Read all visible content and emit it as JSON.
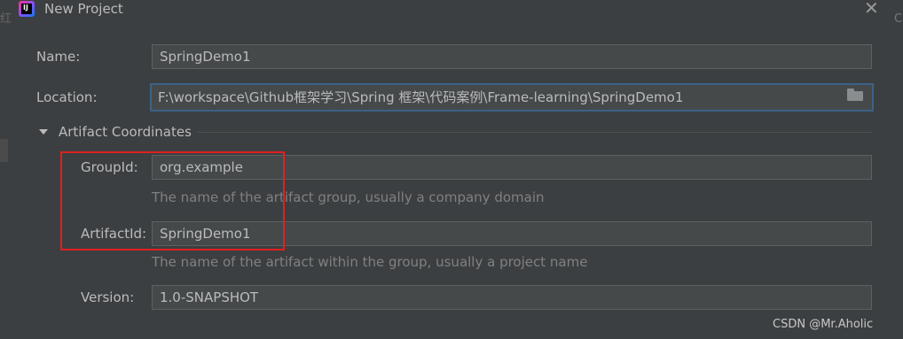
{
  "window": {
    "title": "New Project",
    "close_glyph": "✕"
  },
  "background": {
    "left_glyph": "红",
    "right_glyph": "C"
  },
  "form": {
    "name": {
      "label": "Name:",
      "value": "SpringDemo1"
    },
    "location": {
      "label": "Location:",
      "value": "F:\\workspace\\Github框架学习\\Spring 框架\\代码案例\\Frame-learning\\SpringDemo1",
      "icon": "folder-icon"
    },
    "artifact_section": {
      "title": "Artifact Coordinates",
      "expanded": true
    },
    "group_id": {
      "label": "GroupId:",
      "value": "org.example",
      "hint": "The name of the artifact group, usually a company domain"
    },
    "artifact_id": {
      "label": "ArtifactId:",
      "value": "SpringDemo1",
      "hint": "The name of the artifact within the group, usually a project name"
    },
    "version": {
      "label": "Version:",
      "value": "1.0-SNAPSHOT"
    }
  },
  "watermark": "CSDN @Mr.Aholic",
  "colors": {
    "dialog_bg": "#3c3f41",
    "field_bg": "#45494a",
    "focus_border": "#3d6185",
    "highlight_box": "#e0201f",
    "hint_text": "#808080"
  }
}
